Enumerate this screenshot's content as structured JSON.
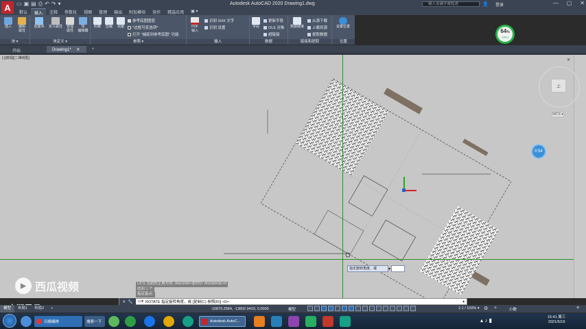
{
  "titlebar": {
    "app_letter": "A",
    "qat_icons": [
      "open-icon",
      "save-icon",
      "saveas-icon",
      "print-icon",
      "undo-icon",
      "redo-icon",
      "share-icon"
    ],
    "title": "Autodesk AutoCAD 2020    Drawing1.dwg",
    "search_placeholder": "键入关键字或短语",
    "sign_in": "登录",
    "min": "—",
    "max": "▢",
    "close": "✕"
  },
  "ribbon_tabs": [
    "默认",
    "插入",
    "注释",
    "参数化",
    "视图",
    "管理",
    "输出",
    "附加模块",
    "协作",
    "精选应用",
    "▣ ▾"
  ],
  "active_ribbon_tab": "插入",
  "ribbon": {
    "insert": "插入",
    "edit_attr": "编辑\n属性",
    "create_block": "创建块",
    "define_attr": "定义属性",
    "manage_attr": "管理\n属性",
    "block_editor": "块\n编辑器",
    "group_block": "块 ▾",
    "group_block_def": "块定义 ▾",
    "attach": "附着",
    "clip": "剪裁",
    "adjust": "调整",
    "ref_underlay": "参考底图图层",
    "frames_vary": "*边框可变选项*",
    "snap_to_ref": "打开 \"捕捉到参考底图\" 功能",
    "group_reference": "参照 ▾",
    "pdf_import": "PDF\n输入",
    "recognize_shx": "识别 SHX 文字",
    "recognize_settings": "识别 设置",
    "group_import": "输入",
    "field": "字段",
    "update_fields": "更新字段",
    "ole_object": "OLE 对象",
    "hyperlink": "超链接",
    "group_data": "数据",
    "data_link": "数据链接",
    "download_source": "从源下载",
    "upload_source": "上载到源",
    "extract_data": "提取数据",
    "group_linking": "链接和提取",
    "set_location": "设置位置",
    "group_location": "位置",
    "locate_icon_label": "位置"
  },
  "cpu_meter": {
    "value": "64",
    "unit": "%",
    "sub": "CPU"
  },
  "file_tabs": [
    "开始",
    "Drawing1*",
    "+"
  ],
  "active_file_tab": "Drawing1*",
  "viewport_label": "[-][俯视][二维线框]",
  "viewcube": {
    "face": "上",
    "wcs": "WCS ▾"
  },
  "nav_badge": "0:54",
  "dynamic_prompt": "指定旋转角度，或",
  "dynamic_input": "",
  "command_history": [
    "UCS 当前的正角方向:  ANGDIR=逆时针  ANGBASE=0",
    "找到 1 个",
    "指定基点:"
  ],
  "command_line": "ROTATE 指定旋转角度，或 [复制(C) 参照(R)] <0>:",
  "watermark": "西瓜视频",
  "watermark_user": "@山涧灵月",
  "layout_tabs": [
    "模型",
    "布局1",
    "布局2",
    "+"
  ],
  "active_layout_tab": "模型",
  "coordinates": "-10875.2584, -13802.9403, 0.0000",
  "mode_label": "模型",
  "scale": "1:1 / 100% ▾",
  "units": "小数",
  "taskbar": {
    "task_1": "日报编排",
    "task_2": "搜索一下",
    "autocad_task": "Autodesk AutoC...",
    "time": "15:41 周三",
    "date": "2021/5/19"
  },
  "colors": {
    "ucs_green": "#2e8b2e",
    "ribbon": "#4b5668",
    "canvas": "#c7c7c7"
  }
}
